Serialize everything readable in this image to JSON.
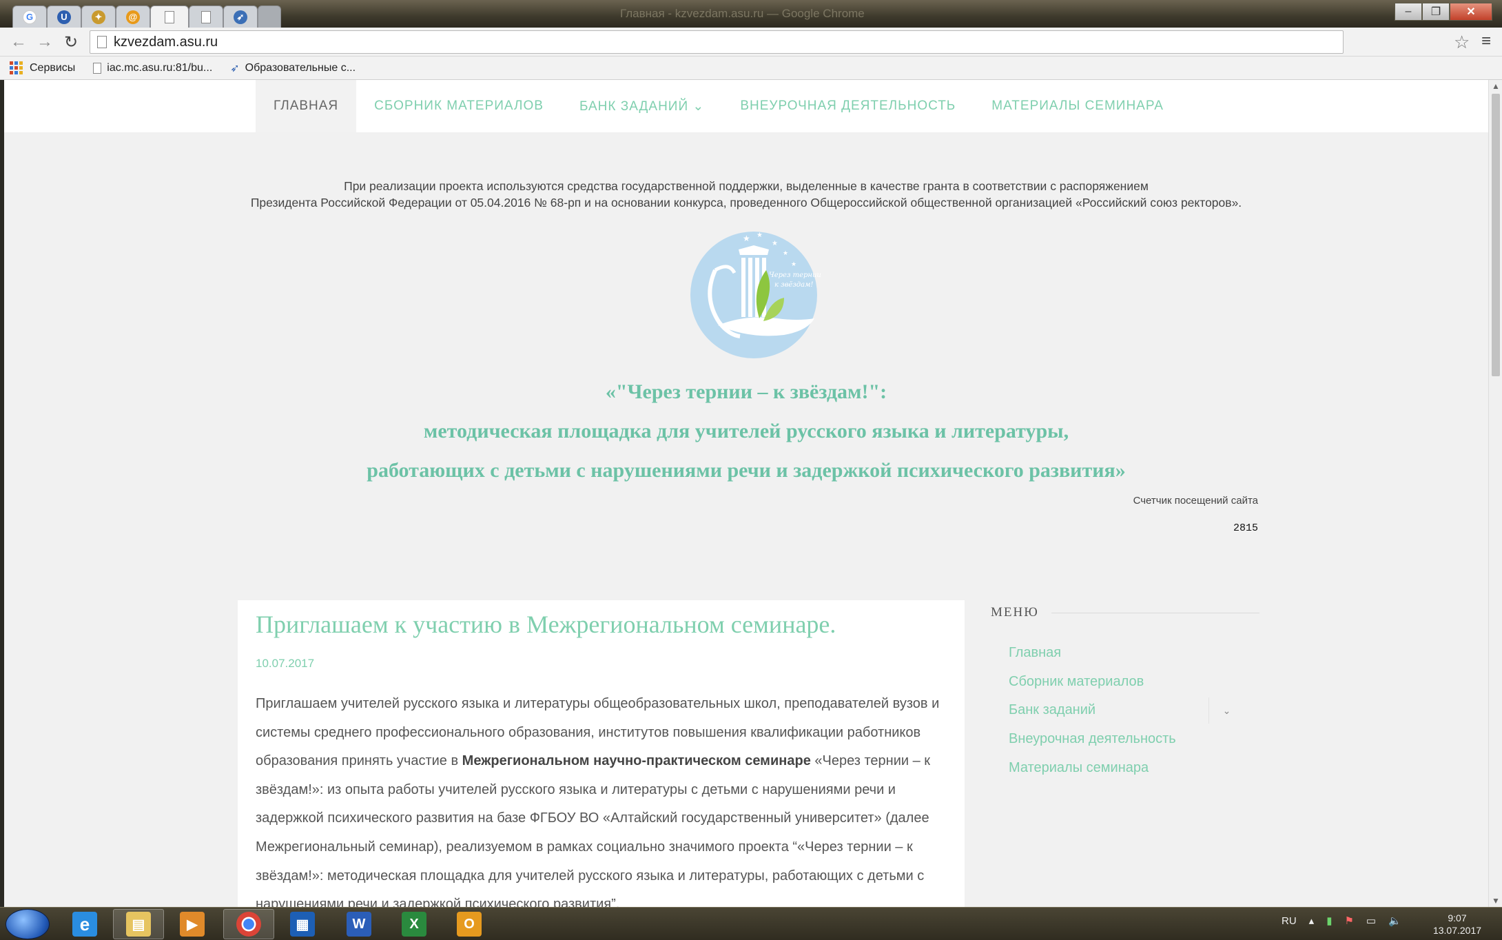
{
  "browser": {
    "window_title": "Главная - kzvezdam.asu.ru — Google Chrome",
    "url": "kzvezdam.asu.ru",
    "bookmarks": [
      {
        "label": "Сервисы",
        "icon": "apps-grid-icon"
      },
      {
        "label": "iac.mc.asu.ru:81/bu...",
        "icon": "page-icon"
      },
      {
        "label": "Образовательные с...",
        "icon": "bookmark-site-icon"
      }
    ]
  },
  "site": {
    "nav": [
      {
        "label": "ГЛАВНАЯ",
        "active": true
      },
      {
        "label": "СБОРНИК МАТЕРИАЛОВ"
      },
      {
        "label": "БАНК ЗАДАНИЙ ⌄"
      },
      {
        "label": "ВНЕУРОЧНАЯ ДЕЯТЕЛЬНОСТЬ"
      },
      {
        "label": "МАТЕРИАЛЫ СЕМИНАРА"
      }
    ],
    "grant_line1": "При реализации проекта используются средства государственной поддержки, выделенные в качестве гранта в соответствии с распоряжением",
    "grant_line2": "Президента Российской Федерации от 05.04.2016 № 68-рп и на основании конкурса, проведенного Общероссийской общественной организацией «Российский союз ректоров».",
    "logo_text_1": "Через тернии",
    "logo_text_2": "к звёздам!",
    "headline_1": "«\"Через тернии – к звёздам!\":",
    "headline_2": "методическая площадка для учителей русского языка и литературы,",
    "headline_3": "работающих с детьми с нарушениями речи и задержкой психического развития»",
    "counter_label": "Счетчик посещений сайта",
    "counter_value": "2815"
  },
  "article": {
    "title": "Приглашаем к участию в Межрегиональном семинаре.",
    "date": "10.07.2017",
    "text_1": "Приглашаем учителей русского языка и литературы общеобразовательных школ, преподавателей вузов и системы среднего профессионального образования, институтов повышения квалификации работников образования принять участие в ",
    "text_bold": "Межрегиональном научно-практическом семинаре",
    "text_2": " «Через тернии – к звёздам!»: из опыта работы учителей русского языка и литературы с детьми с нарушениями речи и задержкой психического развития на базе ФГБОУ ВО «Алтайский государственный университет» (далее Межрегиональный семинар), реализуемом в рамках социально значимого проекта “«Через тернии – к звёздам!»: методическая площадка для учителей русского языка и литературы, работающих с детьми с нарушениями речи и задержкой психического развития”."
  },
  "sidebar": {
    "title": "МЕНЮ",
    "items": [
      "Главная",
      "Сборник материалов",
      "Банк заданий",
      "Внеурочная деятельность",
      "Материалы семинара"
    ]
  },
  "taskbar": {
    "language": "RU",
    "time": "9:07",
    "date": "13.07.2017"
  },
  "colors": {
    "accent": "#7fcfae",
    "headline": "#6cc2a6"
  }
}
